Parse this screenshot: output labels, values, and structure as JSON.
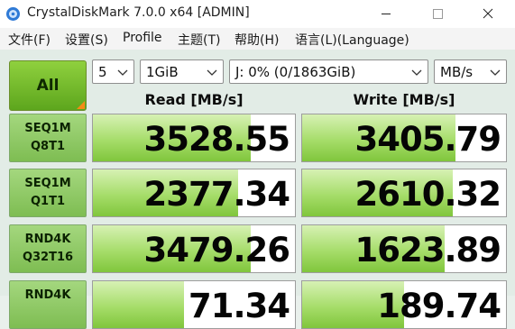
{
  "window": {
    "title": "CrystalDiskMark 7.0.0 x64 [ADMIN]",
    "controls": [
      "minimize-icon",
      "maximize-icon",
      "close-icon"
    ]
  },
  "menu": [
    "文件(F)",
    "设置(S)",
    "Profile",
    "主题(T)",
    "帮助(H)",
    "语言(L)(Language)"
  ],
  "toolbar": {
    "all_label": "All",
    "count": "5",
    "size": "1GiB",
    "drive": "J: 0% (0/1863GiB)",
    "unit": "MB/s"
  },
  "headers": {
    "read": "Read [MB/s]",
    "write": "Write [MB/s]"
  },
  "rows": [
    {
      "line1": "SEQ1M",
      "line2": "Q8T1",
      "read": "3528.55",
      "write": "3405.79",
      "read_fill": 0.78,
      "write_fill": 0.75
    },
    {
      "line1": "SEQ1M",
      "line2": "Q1T1",
      "read": "2377.34",
      "write": "2610.32",
      "read_fill": 0.72,
      "write_fill": 0.74
    },
    {
      "line1": "RND4K",
      "line2": "Q32T16",
      "read": "3479.26",
      "write": "1623.89",
      "read_fill": 0.78,
      "write_fill": 0.7
    },
    {
      "line1": "RND4K",
      "line2": "",
      "read": "71.34",
      "write": "189.74",
      "read_fill": 0.45,
      "write_fill": 0.5
    }
  ],
  "colors": {
    "accent_green": "#80c63c",
    "all_button": "#5da61d",
    "corner_orange": "#f58a15"
  }
}
